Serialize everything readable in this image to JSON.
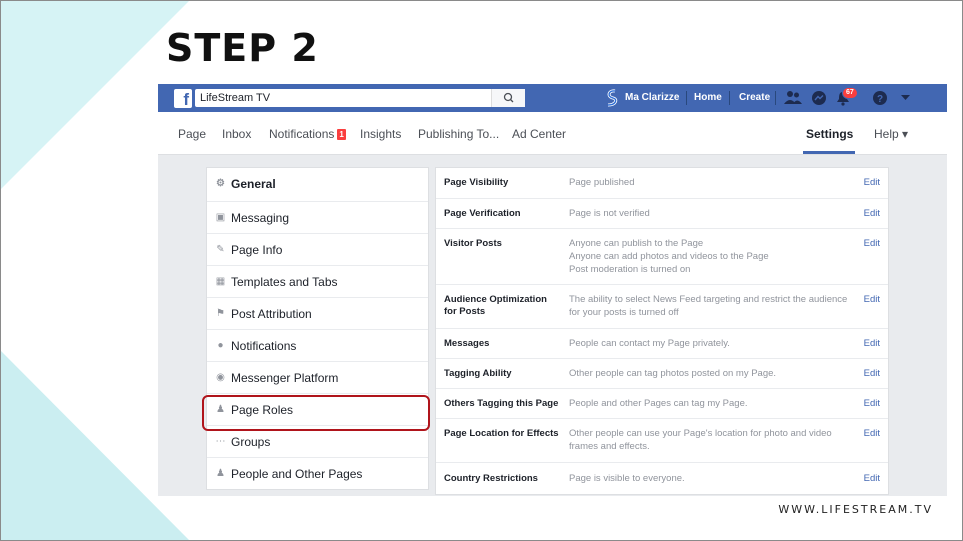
{
  "slide": {
    "title": "STEP 2",
    "footer_url": "WWW.LIFESTREAM.TV"
  },
  "fb_header": {
    "logo_letter": "f",
    "search_value": "LifeStream TV",
    "user_name": "Ma Clarizze",
    "home_label": "Home",
    "create_label": "Create",
    "notifications_count": "67",
    "brand_color": "#4267b2"
  },
  "page_tabs": {
    "page": "Page",
    "inbox": "Inbox",
    "notifications": "Notifications",
    "notifications_badge": "1",
    "insights": "Insights",
    "publishing": "Publishing To...",
    "ad_center": "Ad Center",
    "settings": "Settings",
    "help": "Help ▾"
  },
  "sidebar": {
    "items": [
      {
        "label": "General",
        "icon": "gear-icon"
      },
      {
        "label": "Messaging",
        "icon": "chat-icon"
      },
      {
        "label": "Page Info",
        "icon": "pencil-icon"
      },
      {
        "label": "Templates and Tabs",
        "icon": "grid-icon"
      },
      {
        "label": "Post Attribution",
        "icon": "flag-icon"
      },
      {
        "label": "Notifications",
        "icon": "globe-icon"
      },
      {
        "label": "Messenger Platform",
        "icon": "messenger-icon"
      },
      {
        "label": "Page Roles",
        "icon": "person-icon"
      },
      {
        "label": "Groups",
        "icon": "group-icon"
      },
      {
        "label": "People and Other Pages",
        "icon": "people-icon"
      }
    ]
  },
  "settings_rows": [
    {
      "label": "Page Visibility",
      "value": "Page published",
      "edit": "Edit"
    },
    {
      "label": "Page Verification",
      "value": "Page is not verified",
      "edit": "Edit"
    },
    {
      "label": "Visitor Posts",
      "value": "Anyone can publish to the Page\nAnyone can add photos and videos to the Page\nPost moderation is turned on",
      "edit": "Edit"
    },
    {
      "label": "Audience Optimization for Posts",
      "value": "The ability to select News Feed targeting and restrict the audience for your posts is turned off",
      "edit": "Edit"
    },
    {
      "label": "Messages",
      "value": "People can contact my Page privately.",
      "edit": "Edit"
    },
    {
      "label": "Tagging Ability",
      "value": "Other people can tag photos posted on my Page.",
      "edit": "Edit"
    },
    {
      "label": "Others Tagging this Page",
      "value": "People and other Pages can tag my Page.",
      "edit": "Edit"
    },
    {
      "label": "Page Location for Effects",
      "value": "Other people can use your Page's location for photo and video frames and effects.",
      "edit": "Edit"
    },
    {
      "label": "Country Restrictions",
      "value": "Page is visible to everyone.",
      "edit": "Edit"
    }
  ]
}
